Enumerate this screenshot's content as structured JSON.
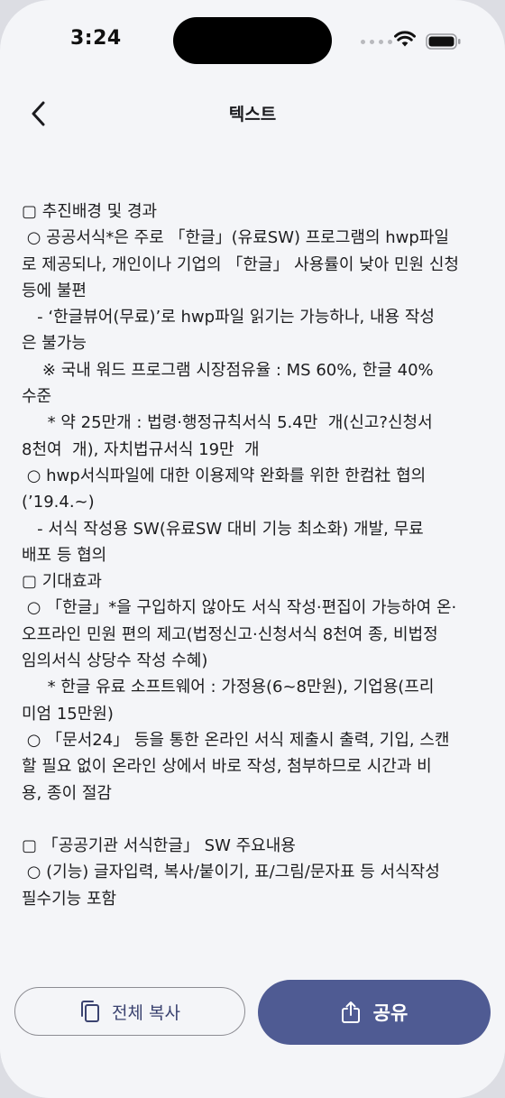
{
  "status_bar": {
    "time": "3:24"
  },
  "header": {
    "title": "텍스트"
  },
  "content": {
    "lines": [
      "▢ 추진배경 및 경과",
      " ○ 공공서식*은 주로 「한글」(유료SW) 프로그램의 hwp파일",
      "로 제공되나, 개인이나 기업의 「한글」 사용률이 낮아 민원 신청",
      "등에 불편",
      "   - ‘한글뷰어(무료)’로 hwp파일 읽기는 가능하나, 내용 작성",
      "은 불가능",
      "    ※ 국내 워드 프로그램 시장점유율 : MS 60%, 한글 40%",
      "수준",
      "     * 약 25만개 : 법령·행정규칙서식 5.4만  개(신고?신청서",
      "8천여  개), 자치법규서식 19만  개",
      " ○ hwp서식파일에 대한 이용제약 완화를 위한 한컴社 협의",
      "(’19.4.~)",
      "   - 서식 작성용 SW(유료SW 대비 기능 최소화) 개발, 무료",
      "배포 등 협의",
      "▢ 기대효과",
      " ○ 「한글」*을 구입하지 않아도 서식 작성·편집이 가능하여 온·",
      "오프라인 민원 편의 제고(법정신고·신청서식 8천여 종, 비법정",
      "임의서식 상당수 작성 수혜)",
      "     * 한글 유료 소프트웨어 : 가정용(6~8만원), 기업용(프리",
      "미엄 15만원)",
      " ○ 「문서24」 등을 통한 온라인 서식 제출시 출력, 기입, 스캔",
      "할 필요 없이 온라인 상에서 바로 작성, 첨부하므로 시간과 비",
      "용, 종이 절감",
      "",
      "▢ 「공공기관 서식한글」 SW 주요내용",
      " ○ (기능) 글자입력, 복사/붙이기, 표/그림/문자표 등 서식작성",
      "필수기능 포함"
    ]
  },
  "actions": {
    "copy_label": "전체 복사",
    "share_label": "공유"
  },
  "colors": {
    "background": "#f4f5f8",
    "accent": "#4f5b93",
    "copy_text": "#3b4370"
  },
  "icons": {
    "back": "chevron-left-icon",
    "copy": "copy-icon",
    "share": "share-icon"
  }
}
